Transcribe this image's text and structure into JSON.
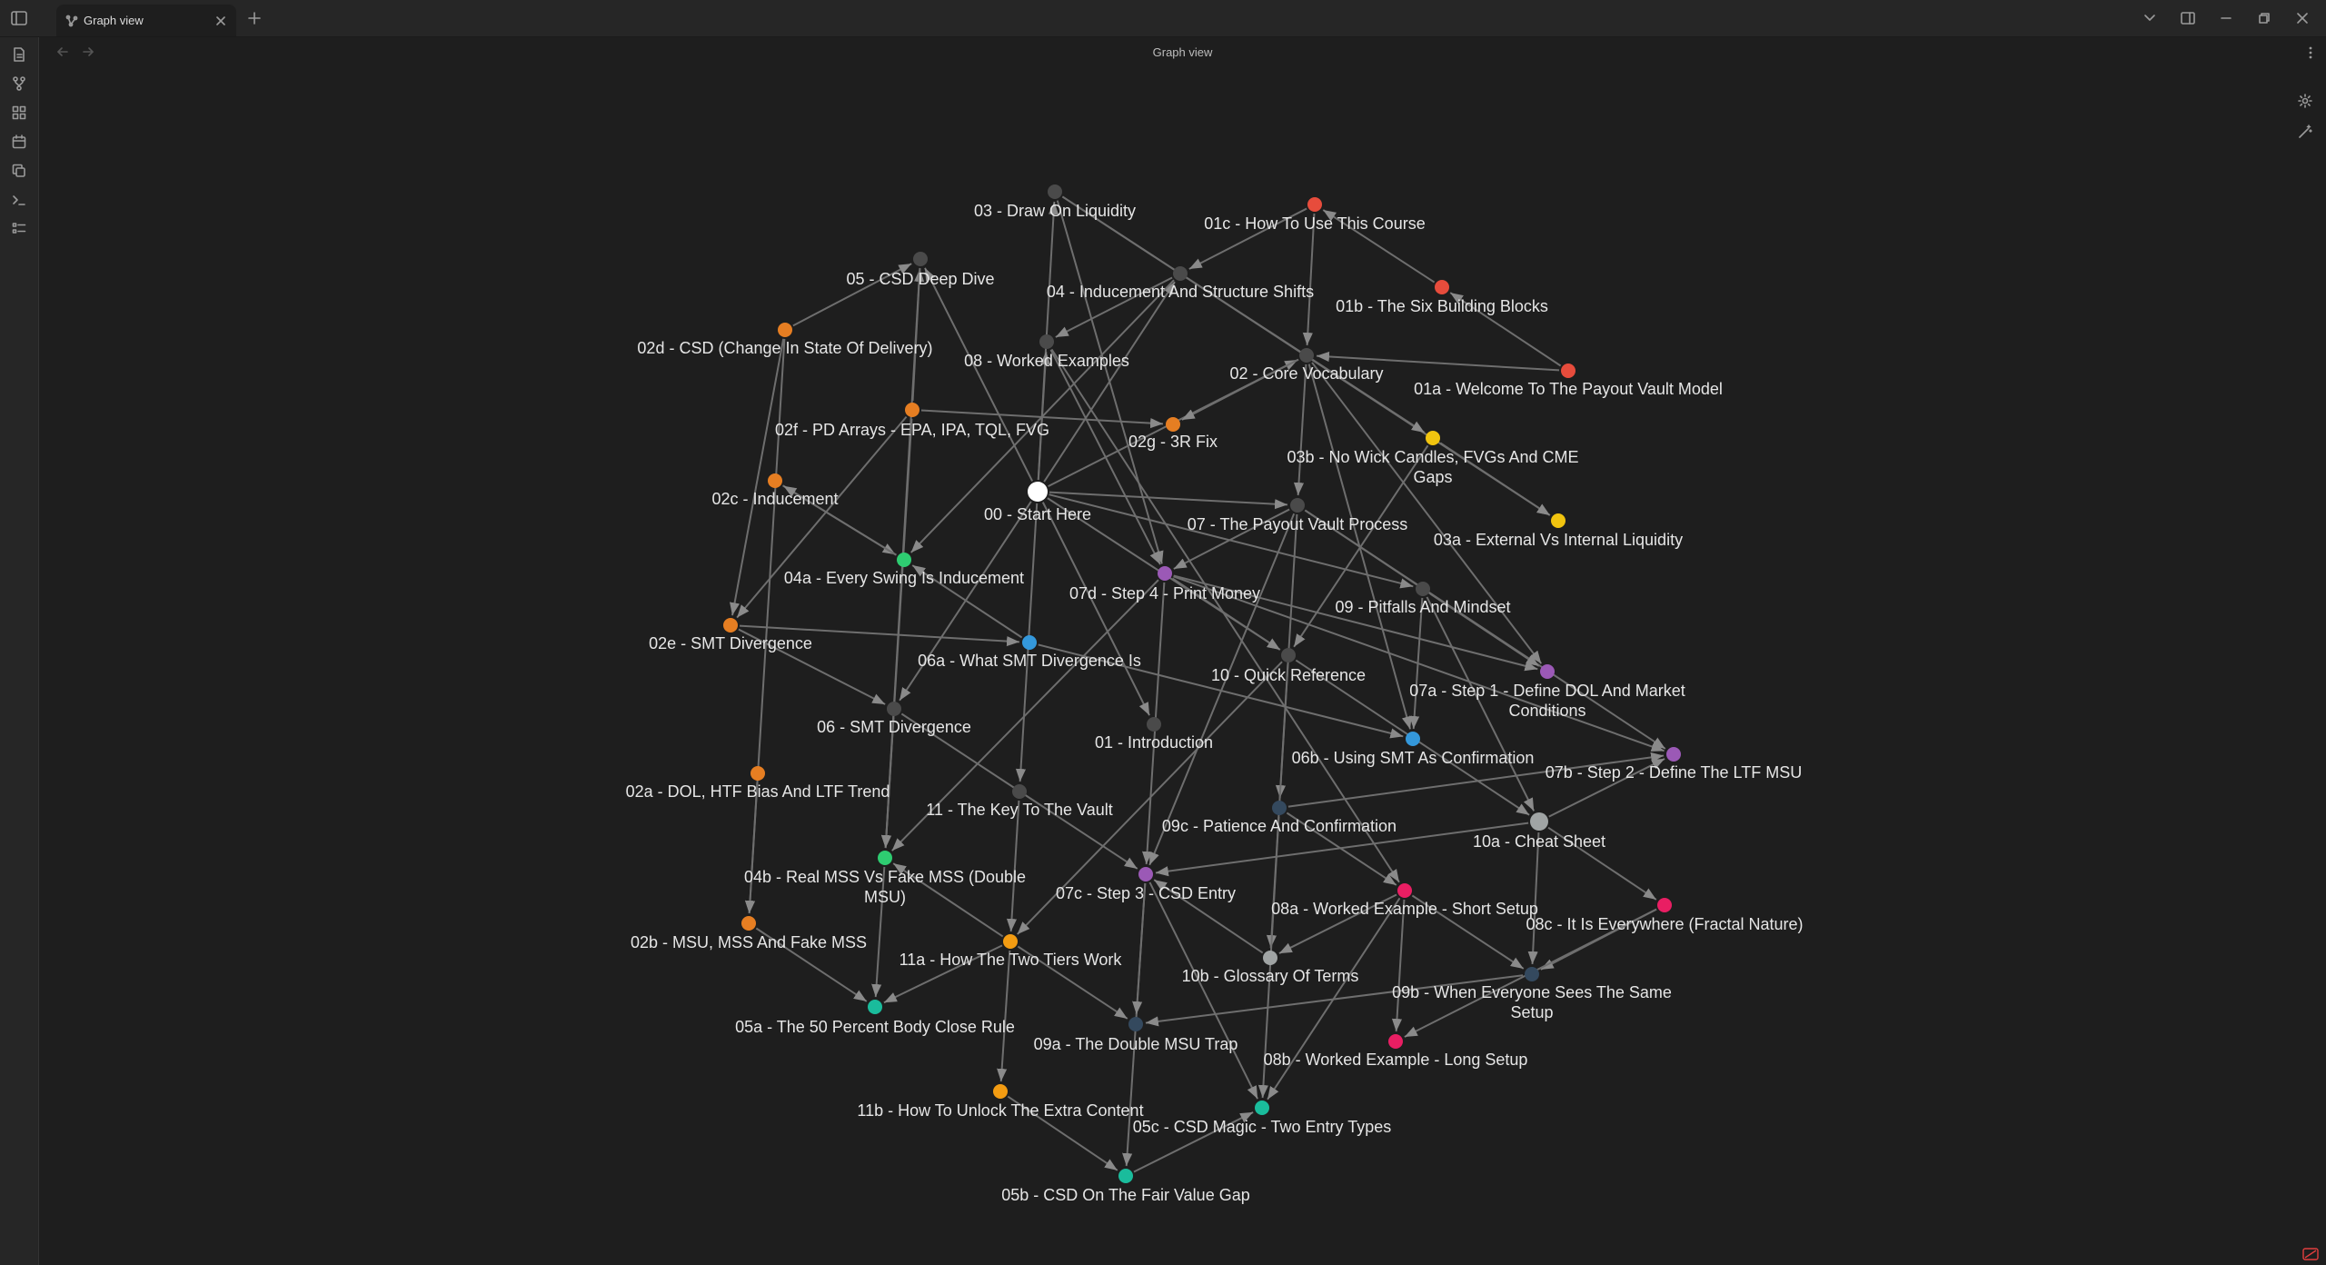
{
  "tab": {
    "label": "Graph view"
  },
  "header": {
    "title": "Graph view"
  },
  "colors": {
    "background": "#1e1e1e",
    "edge": "#6e6e6e",
    "node_default": "#4a4a4a",
    "node_active": "#ffffff",
    "orange": "#e67e22",
    "amber": "#f39c12",
    "red": "#e74c3c",
    "yellow": "#f1c40f",
    "green": "#2ecc71",
    "blue": "#3498db",
    "purple": "#9b59b6",
    "teal": "#1abc9c",
    "pink": "#e91e63",
    "navy": "#34495e",
    "light_gray": "#a0a4a4"
  },
  "icons": {
    "ribbon": [
      "file-icon",
      "git-branch-icon",
      "grid-icon",
      "calendar-icon",
      "copy-icon",
      "terminal-icon",
      "list-icon"
    ],
    "graph_controls": [
      "gear-icon",
      "magic-wand-icon"
    ],
    "status": "no-sync-icon"
  },
  "graph": {
    "nodes": [
      {
        "id": "n00",
        "label": "00 - Start Here",
        "color": "node_active",
        "size": "large"
      },
      {
        "id": "n01",
        "label": "01 - Introduction",
        "color": "node_default"
      },
      {
        "id": "n01a",
        "label": "01a - Welcome To The Payout Vault Model",
        "color": "red"
      },
      {
        "id": "n01b",
        "label": "01b - The Six Building Blocks",
        "color": "red"
      },
      {
        "id": "n01c",
        "label": "01c - How To Use This Course",
        "color": "red"
      },
      {
        "id": "n02",
        "label": "02 - Core Vocabulary",
        "color": "node_default"
      },
      {
        "id": "n02a",
        "label": "02a - DOL, HTF Bias And LTF Trend",
        "color": "orange"
      },
      {
        "id": "n02b",
        "label": "02b - MSU, MSS And Fake MSS",
        "color": "orange"
      },
      {
        "id": "n02c",
        "label": "02c - Inducement",
        "color": "orange"
      },
      {
        "id": "n02d",
        "label": "02d - CSD (Change In State Of Delivery)",
        "color": "orange"
      },
      {
        "id": "n02e",
        "label": "02e - SMT Divergence",
        "color": "orange"
      },
      {
        "id": "n02f",
        "label": "02f - PD Arrays - EPA, IPA, TQL, FVG",
        "color": "orange"
      },
      {
        "id": "n02g",
        "label": "02g - 3R Fix",
        "color": "orange"
      },
      {
        "id": "n03",
        "label": "03 - Draw On Liquidity",
        "color": "node_default"
      },
      {
        "id": "n03a",
        "label": "03a - External Vs Internal Liquidity",
        "color": "yellow"
      },
      {
        "id": "n03b",
        "label": [
          "03b - No Wick Candles, FVGs And CME",
          "Gaps"
        ],
        "color": "yellow"
      },
      {
        "id": "n04",
        "label": "04 - Inducement And Structure Shifts",
        "color": "node_default"
      },
      {
        "id": "n04a",
        "label": "04a - Every Swing Is Inducement",
        "color": "green"
      },
      {
        "id": "n04b",
        "label": [
          "04b - Real MSS Vs Fake MSS (Double",
          "MSU)"
        ],
        "color": "green"
      },
      {
        "id": "n05",
        "label": "05 - CSD Deep Dive",
        "color": "node_default"
      },
      {
        "id": "n05a",
        "label": "05a - The 50 Percent Body Close Rule",
        "color": "teal"
      },
      {
        "id": "n05b",
        "label": "05b - CSD On The Fair Value Gap",
        "color": "teal"
      },
      {
        "id": "n05c",
        "label": "05c - CSD Magic - Two Entry Types",
        "color": "teal"
      },
      {
        "id": "n06",
        "label": "06 - SMT Divergence",
        "color": "node_default"
      },
      {
        "id": "n06a",
        "label": "06a - What SMT Divergence Is",
        "color": "blue"
      },
      {
        "id": "n06b",
        "label": "06b - Using SMT As Confirmation",
        "color": "blue"
      },
      {
        "id": "n07",
        "label": "07 - The Payout Vault Process",
        "color": "node_default"
      },
      {
        "id": "n07a",
        "label": [
          "07a - Step 1 - Define DOL And Market",
          "Conditions"
        ],
        "color": "purple"
      },
      {
        "id": "n07b",
        "label": "07b - Step 2 - Define The LTF MSU",
        "color": "purple"
      },
      {
        "id": "n07c",
        "label": "07c - Step 3 - CSD Entry",
        "color": "purple"
      },
      {
        "id": "n07d",
        "label": "07d - Step 4 - Print Money",
        "color": "purple"
      },
      {
        "id": "n08",
        "label": "08 - Worked Examples",
        "color": "node_default"
      },
      {
        "id": "n08a",
        "label": "08a - Worked Example - Short Setup",
        "color": "pink"
      },
      {
        "id": "n08b",
        "label": "08b - Worked Example - Long Setup",
        "color": "pink"
      },
      {
        "id": "n08c",
        "label": "08c - It Is Everywhere (Fractal Nature)",
        "color": "pink"
      },
      {
        "id": "n09",
        "label": "09 - Pitfalls And Mindset",
        "color": "node_default"
      },
      {
        "id": "n09a",
        "label": "09a - The Double MSU Trap",
        "color": "navy"
      },
      {
        "id": "n09b",
        "label": [
          "09b - When Everyone Sees The Same",
          "Setup"
        ],
        "color": "navy"
      },
      {
        "id": "n09c",
        "label": "09c - Patience And Confirmation",
        "color": "navy"
      },
      {
        "id": "n10",
        "label": "10 - Quick Reference",
        "color": "node_default"
      },
      {
        "id": "n10a",
        "label": "10a - Cheat Sheet",
        "color": "light_gray",
        "size": "medium"
      },
      {
        "id": "n10b",
        "label": "10b - Glossary Of Terms",
        "color": "light_gray"
      },
      {
        "id": "n11",
        "label": "11 - The Key To The Vault",
        "color": "node_default"
      },
      {
        "id": "n11a",
        "label": "11a - How The Two Tiers Work",
        "color": "amber"
      },
      {
        "id": "n11b",
        "label": "11b - How To Unlock The Extra Content",
        "color": "amber"
      }
    ],
    "edges": [
      [
        "n00",
        "n01"
      ],
      [
        "n00",
        "n02"
      ],
      [
        "n00",
        "n03"
      ],
      [
        "n00",
        "n04"
      ],
      [
        "n00",
        "n05"
      ],
      [
        "n00",
        "n06"
      ],
      [
        "n00",
        "n07"
      ],
      [
        "n00",
        "n08"
      ],
      [
        "n00",
        "n09"
      ],
      [
        "n00",
        "n10"
      ],
      [
        "n00",
        "n11"
      ],
      [
        "n01a",
        "n01b"
      ],
      [
        "n01b",
        "n01c"
      ],
      [
        "n01c",
        "n04"
      ],
      [
        "n01c",
        "n02"
      ],
      [
        "n01a",
        "n02"
      ],
      [
        "n02",
        "n02g"
      ],
      [
        "n02",
        "n07"
      ],
      [
        "n02",
        "n07a"
      ],
      [
        "n02",
        "n06b"
      ],
      [
        "n02f",
        "n02g"
      ],
      [
        "n02f",
        "n05"
      ],
      [
        "n02f",
        "n02e"
      ],
      [
        "n02f",
        "n04b"
      ],
      [
        "n02d",
        "n05"
      ],
      [
        "n02d",
        "n02e"
      ],
      [
        "n02d",
        "n02b"
      ],
      [
        "n02c",
        "n04a"
      ],
      [
        "n02a",
        "n02b"
      ],
      [
        "n02e",
        "n06"
      ],
      [
        "n02e",
        "n06a"
      ],
      [
        "n03",
        "n03a"
      ],
      [
        "n03",
        "n03b"
      ],
      [
        "n03",
        "n07d"
      ],
      [
        "n03b",
        "n03a"
      ],
      [
        "n03b",
        "n10"
      ],
      [
        "n04",
        "n08"
      ],
      [
        "n04",
        "n04a"
      ],
      [
        "n04a",
        "n02c"
      ],
      [
        "n06a",
        "n06b"
      ],
      [
        "n06a",
        "n04a"
      ],
      [
        "n06",
        "n07c"
      ],
      [
        "n06",
        "n04b"
      ],
      [
        "n07",
        "n07a"
      ],
      [
        "n07",
        "n07b"
      ],
      [
        "n07",
        "n07c"
      ],
      [
        "n07",
        "n07d"
      ],
      [
        "n07",
        "n09c"
      ],
      [
        "n07d",
        "n07a"
      ],
      [
        "n07d",
        "n07b"
      ],
      [
        "n07d",
        "n10"
      ],
      [
        "n07d",
        "n04b"
      ],
      [
        "n07d",
        "n07c"
      ],
      [
        "n10",
        "n10a"
      ],
      [
        "n10",
        "n10b"
      ],
      [
        "n10",
        "n11a"
      ],
      [
        "n10a",
        "n08c"
      ],
      [
        "n10a",
        "n07c"
      ],
      [
        "n10a",
        "n09b"
      ],
      [
        "n10a",
        "n07b"
      ],
      [
        "n09c",
        "n08a"
      ],
      [
        "n09c",
        "n07b"
      ],
      [
        "n09c",
        "n05c"
      ],
      [
        "n08",
        "n07d"
      ],
      [
        "n08",
        "n08a"
      ],
      [
        "n08a",
        "n08b"
      ],
      [
        "n08a",
        "n05c"
      ],
      [
        "n08a",
        "n10b"
      ],
      [
        "n08a",
        "n09b"
      ],
      [
        "n08c",
        "n09b"
      ],
      [
        "n08c",
        "n08b"
      ],
      [
        "n09b",
        "n09a"
      ],
      [
        "n11",
        "n11a"
      ],
      [
        "n11a",
        "n11b"
      ],
      [
        "n11a",
        "n04b"
      ],
      [
        "n11a",
        "n09a"
      ],
      [
        "n11a",
        "n05a"
      ],
      [
        "n11b",
        "n05b"
      ],
      [
        "n05b",
        "n05c"
      ],
      [
        "n02b",
        "n05a"
      ],
      [
        "n04b",
        "n05a"
      ],
      [
        "n05",
        "n04b"
      ],
      [
        "n09",
        "n07a"
      ],
      [
        "n09",
        "n06b"
      ],
      [
        "n09",
        "n10a"
      ],
      [
        "n07c",
        "n05b"
      ],
      [
        "n07c",
        "n05c"
      ],
      [
        "n07c",
        "n09a"
      ],
      [
        "n10b",
        "n07c"
      ]
    ]
  }
}
